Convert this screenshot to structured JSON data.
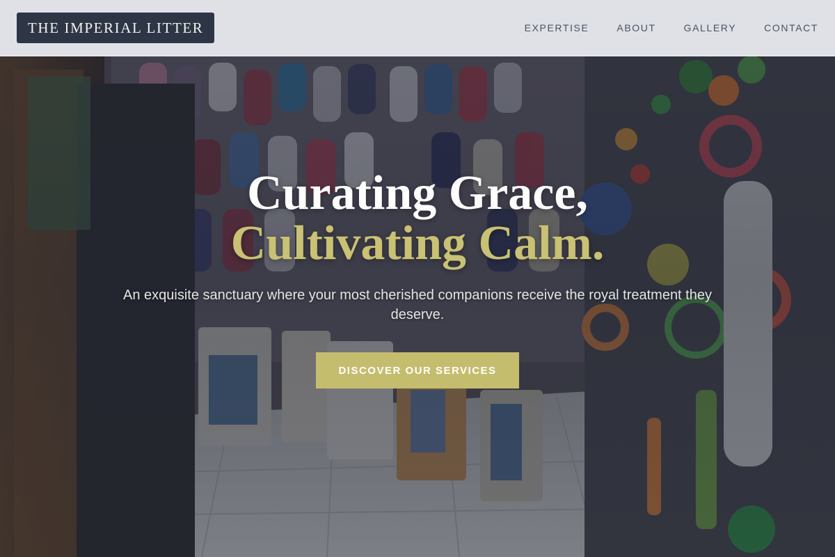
{
  "brand": {
    "name": "THE IMPERIAL LITTER"
  },
  "nav": {
    "items": [
      {
        "label": "EXPERTISE"
      },
      {
        "label": "ABOUT"
      },
      {
        "label": "GALLERY"
      },
      {
        "label": "CONTACT"
      }
    ]
  },
  "hero": {
    "headline_line1": "Curating Grace,",
    "headline_line2": "Cultivating Calm.",
    "subtitle": "An exquisite sanctuary where your most cherished companions receive the royal treatment they deserve.",
    "cta_label": "DISCOVER OUR SERVICES",
    "background_image": "pet-shop-interior-photo"
  },
  "colors": {
    "accent_gold": "#c5bd6e",
    "headline_gold": "#c9c173",
    "logo_bg": "#2e3646",
    "header_bg": "#eceef2",
    "nav_text": "#4a5060"
  }
}
